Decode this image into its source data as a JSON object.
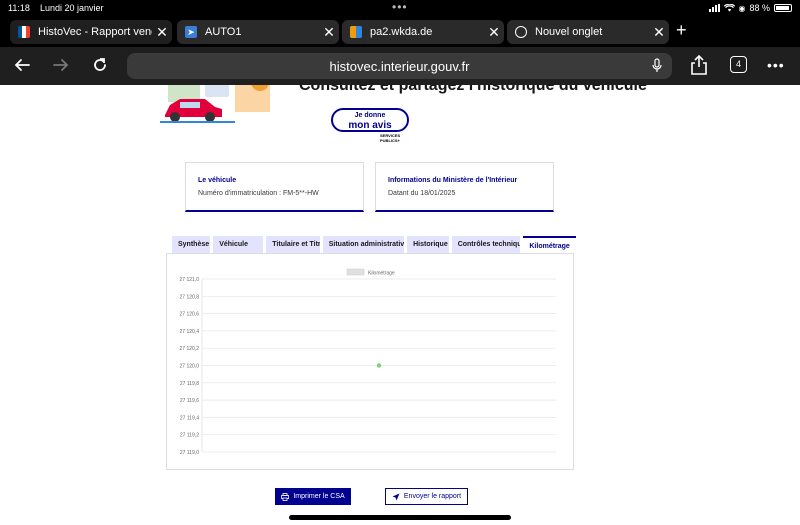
{
  "status_bar": {
    "time": "11:18",
    "date": "Lundi 20 janvier",
    "battery": "88 %"
  },
  "browser": {
    "tabs": [
      {
        "title": "HistoVec - Rapport vendeu",
        "active": true,
        "favicon": "flag-icon"
      },
      {
        "title": "AUTO1",
        "active": false,
        "favicon": "auto1-icon"
      },
      {
        "title": "pa2.wkda.de",
        "active": false,
        "favicon": "wkda-icon"
      },
      {
        "title": "Nouvel onglet",
        "active": false,
        "favicon": "globe-icon"
      }
    ],
    "url": "histovec.interieur.gouv.fr",
    "tab_count": "4"
  },
  "page": {
    "hero_title": "Consultez et partagez l'historique du véhicule",
    "avis_button": {
      "line1": "Je donne",
      "line2": "mon avis"
    },
    "services_logo": {
      "line1": "SERVICES",
      "line2": "PUBLICS+"
    },
    "vehicle_card": {
      "title": "Le véhicule",
      "value": "Numéro d'immatriculation : FM-5**-HW"
    },
    "ministry_card": {
      "title": "Informations du Ministère de l'Intérieur",
      "value": "Datant du 18/01/2025"
    },
    "tabs": [
      "Synthèse",
      "Véhicule",
      "Titulaire et Titre",
      "Situation administrative",
      "Historique",
      "Contrôles techniques",
      "Kilométrage"
    ],
    "active_tab_index": 6,
    "print_button": "Imprimer le CSA",
    "send_button": "Envoyer le rapport"
  },
  "chart_data": {
    "type": "scatter",
    "series": [
      {
        "name": "Kilométrage",
        "points": [
          [
            0.5,
            27120.0
          ]
        ]
      }
    ],
    "ylim": [
      27119.0,
      27121.0
    ],
    "y_ticks": [
      "27 121,0",
      "27 120,8",
      "27 120,6",
      "27 120,4",
      "27 120,2",
      "27 120,0",
      "27 119,8",
      "27 119,6",
      "27 119,4",
      "27 119,2",
      "27 119,0"
    ],
    "grid": true,
    "legend": "top-center",
    "colors": {
      "point": "#7fd17a",
      "grid": "#e6e6e6",
      "legend_box": "#e0e0e0"
    }
  },
  "colors": {
    "brand": "#000091",
    "tab_bg": "#e3e3fd"
  }
}
